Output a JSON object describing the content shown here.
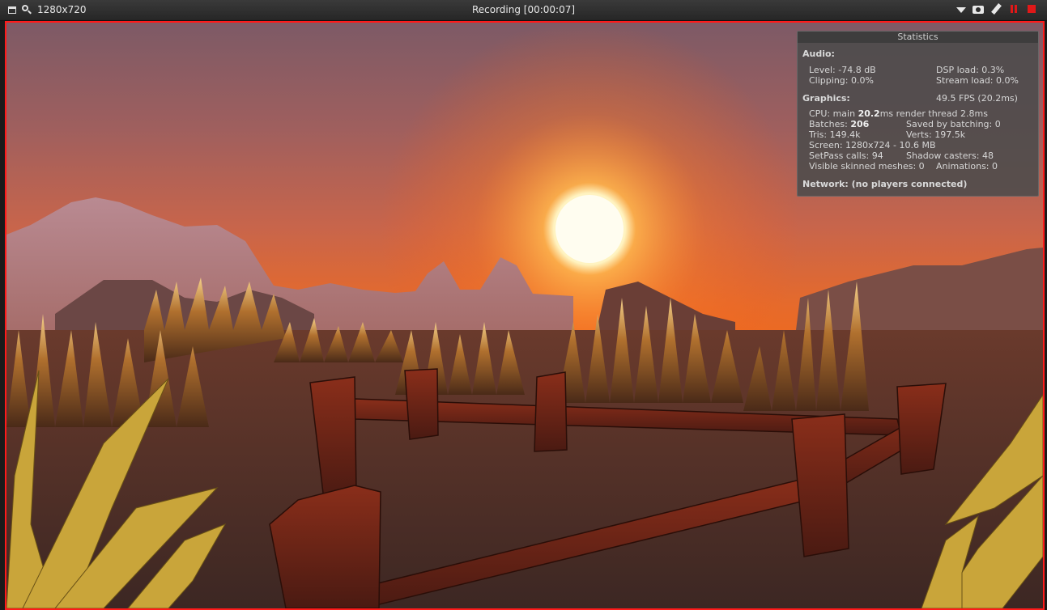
{
  "toolbar": {
    "resolution": "1280x720",
    "title": "Recording [00:00:07]",
    "icons": [
      "window-icon",
      "zoom-icon",
      "dropdown-icon",
      "camera-icon",
      "pen-icon",
      "pause-icon",
      "stop-icon"
    ],
    "record_color": "#e01818"
  },
  "viewport": {
    "border_color": "#ff1a1a"
  },
  "stats": {
    "title": "Statistics",
    "audio_label": "Audio:",
    "level": "Level: -74.8 dB",
    "dsp_load": "DSP load: 0.3%",
    "clipping": "Clipping: 0.0%",
    "stream_load": "Stream load: 0.0%",
    "graphics_label": "Graphics:",
    "fps": "49.5 FPS (20.2ms)",
    "cpu_prefix": "CPU: main ",
    "cpu_main": "20.2",
    "cpu_suffix": "ms  render thread 2.8ms",
    "batches_prefix": "Batches: ",
    "batches": "206",
    "saved_by_batching": "Saved by batching: 0",
    "tris": "Tris: 149.4k",
    "verts": "Verts: 197.5k",
    "screen": "Screen: 1280x724 - 10.6 MB",
    "setpass": "SetPass calls: 94",
    "shadow_casters": "Shadow casters: 48",
    "skinned": "Visible skinned meshes: 0",
    "animations": "Animations: 0",
    "network": "Network: (no players connected)"
  }
}
